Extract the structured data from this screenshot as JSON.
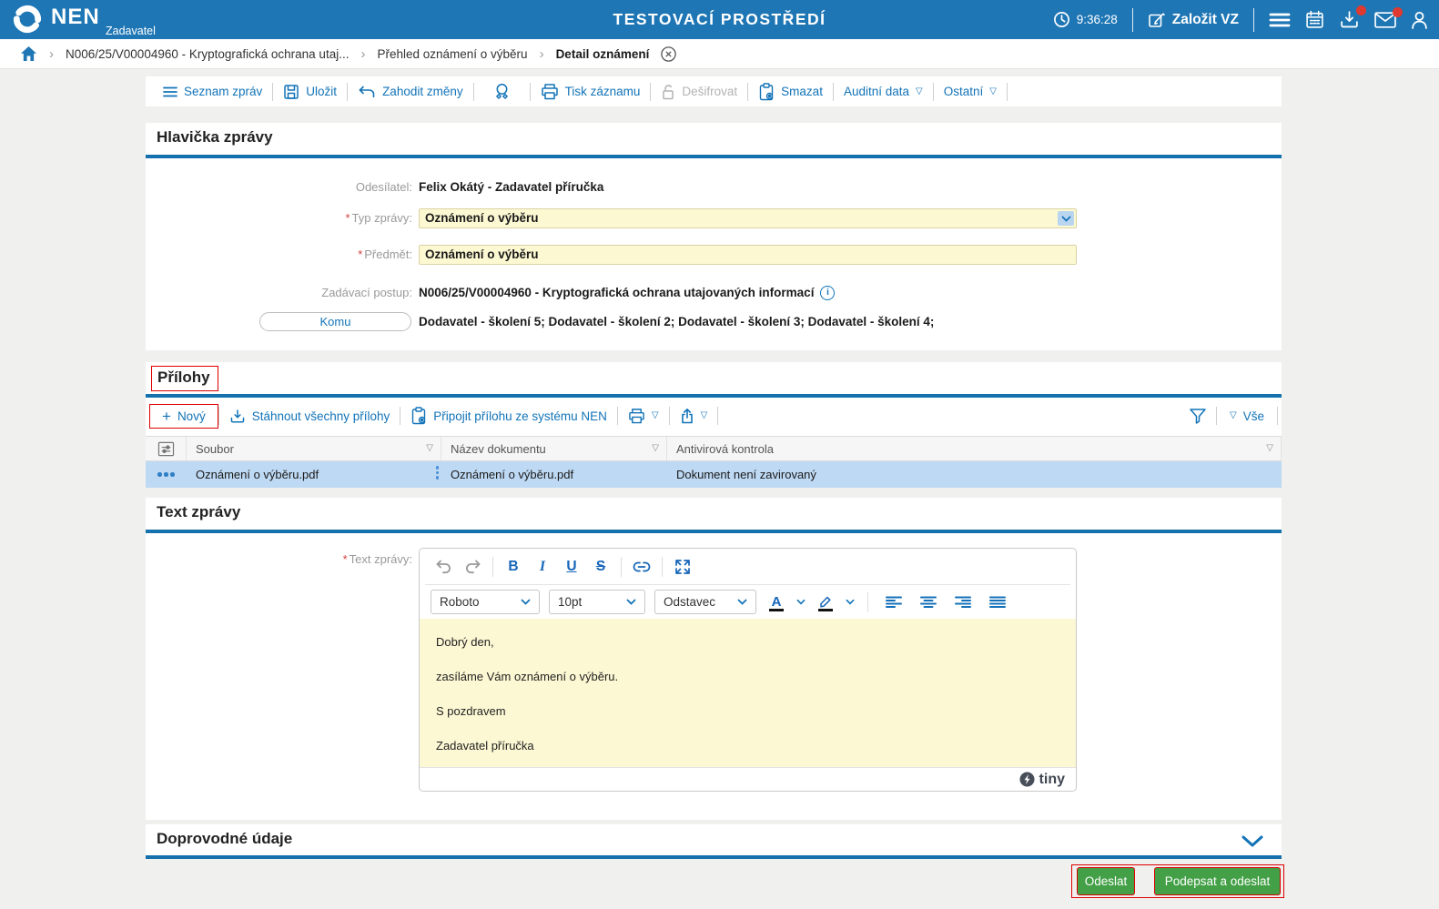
{
  "icons": {
    "caret_down": "▽",
    "breadcrumb_sep": "›",
    "plus": "+",
    "info_glyph": "i",
    "color_letter": "A"
  },
  "required_mark": "*",
  "topbar": {
    "brand": "NEN",
    "brand_sub": "Zadavatel",
    "title": "TESTOVACÍ PROSTŘEDÍ",
    "time": "9:36:28",
    "create_vz": "Založit VZ"
  },
  "breadcrumb": {
    "items": [
      "N006/25/V00004960 - Kryptografická ochrana utaj...",
      "Přehled oznámení o výběru",
      "Detail oznámení"
    ]
  },
  "toolbar": {
    "seznam_zprav": "Seznam zpráv",
    "ulozit": "Uložit",
    "zahodit_zmeny": "Zahodit změny",
    "tisk_zaznamu": "Tisk záznamu",
    "desifrovat": "Dešifrovat",
    "smazat": "Smazat",
    "auditni_data": "Auditní data",
    "ostatni": "Ostatní"
  },
  "hlavicka": {
    "title": "Hlavička zprávy",
    "odesilatel_label": "Odesílatel:",
    "odesilatel_value": "Felix Okátý - Zadavatel příručka",
    "typ_label": "Typ zprávy:",
    "typ_value": "Oznámení o výběru",
    "predmet_label": "Předmět:",
    "predmet_value": "Oznámení o výběru",
    "postup_label": "Zadávací postup:",
    "postup_value": "N006/25/V00004960 - Kryptografická ochrana utajovaných informací",
    "komu_label": "Komu",
    "komu_value": "Dodavatel - školení 5; Dodavatel - školení 2; Dodavatel - školení 3; Dodavatel - školení 4;"
  },
  "prilohy": {
    "title": "Přílohy",
    "novy": "Nový",
    "stahnout": "Stáhnout všechny přílohy",
    "pripojit": "Připojit přílohu ze systému NEN",
    "vse": "Vše",
    "columns": {
      "soubor": "Soubor",
      "nazev": "Název dokumentu",
      "antivir": "Antivirová kontrola"
    },
    "row": {
      "soubor": "Oznámení o výběru.pdf",
      "nazev": "Oznámení o výběru.pdf",
      "antivir": "Dokument není zavirovaný"
    }
  },
  "text_zpravy": {
    "title": "Text zprávy",
    "label": "Text zprávy:",
    "editor": {
      "font": "Roboto",
      "size": "10pt",
      "block": "Odstavec",
      "bold": "B",
      "italic": "I",
      "underline": "U",
      "strike": "S",
      "lines": [
        "Dobrý den,",
        "zasíláme Vám oznámení o výběru.",
        "S pozdravem",
        "Zadavatel příručka"
      ],
      "brand": "tiny"
    }
  },
  "doprovodne": {
    "title": "Doprovodné údaje"
  },
  "actions": {
    "odeslat": "Odeslat",
    "podepsat": "Podepsat a odeslat"
  },
  "colors": {
    "topbar_blue": "#1e76b5",
    "accent_blue": "#1273b8",
    "rule_blue": "#1471ad",
    "field_yellow": "#fcf8d2",
    "row_selected": "#bed9f3",
    "button_green": "#43a047",
    "annotation_red": "#dd0000",
    "badge_red": "#e0392f"
  }
}
